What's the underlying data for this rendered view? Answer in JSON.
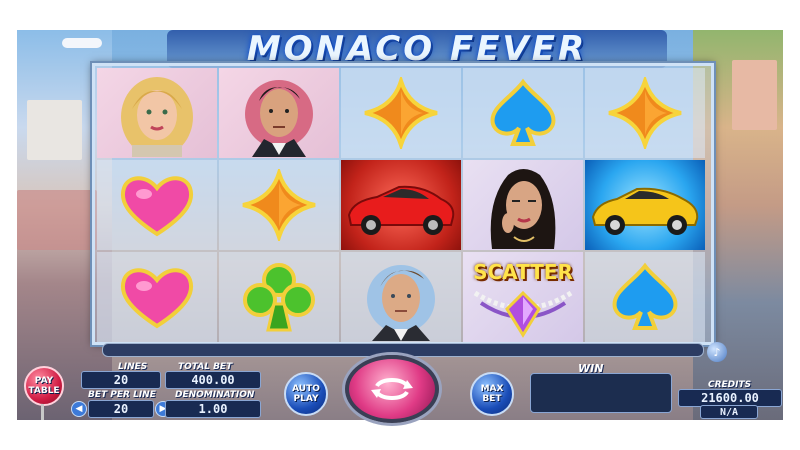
{
  "game": {
    "title": "MONACO FEVER"
  },
  "reels": [
    [
      "blonde-woman",
      "pink-heart",
      "pink-heart"
    ],
    [
      "dark-haired-man",
      "orange-diamond",
      "green-club"
    ],
    [
      "orange-diamond",
      "red-sports-car",
      "brown-haired-man"
    ],
    [
      "blue-spade",
      "brunette-woman",
      "scatter-jewel"
    ],
    [
      "orange-diamond",
      "yellow-sports-car",
      "blue-spade"
    ]
  ],
  "scatter_label": "SCATTER",
  "controls": {
    "pay_table": "PAY TABLE",
    "lines_label": "LINES",
    "lines_value": "20",
    "total_bet_label": "TOTAL BET",
    "total_bet_value": "400.00",
    "bet_per_line_label": "BET PER LINE",
    "bet_per_line_value": "20",
    "denomination_label": "DENOMINATION",
    "denomination_value": "1.00",
    "auto_play_label": "AUTO PLAY",
    "max_bet_label": "MAX BET",
    "win_label": "WIN",
    "credits_label": "CREDITS",
    "credits_value": "21600.00",
    "credits_sub_value": "N/A"
  },
  "colors": {
    "accent_blue": "#1a4db8",
    "spin_pink": "#e03b86",
    "pay_table_red": "#d11d45",
    "panel_dark": "#182a52"
  }
}
